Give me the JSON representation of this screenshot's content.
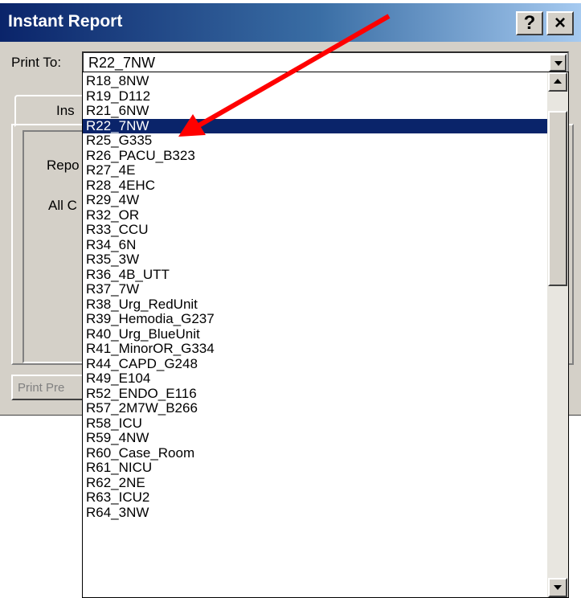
{
  "window": {
    "title": "Instant Report",
    "help_label": "?",
    "close_label": "×"
  },
  "print_to": {
    "label": "Print To:",
    "value": "R22_7NW"
  },
  "tab": {
    "label": "Ins"
  },
  "labels": {
    "report": "Repo",
    "all": "All C"
  },
  "print_preview": {
    "label": "Print Pre"
  },
  "dropdown": {
    "items": [
      "R18_8NW",
      "R19_D112",
      "R21_6NW",
      "R22_7NW",
      "R25_G335",
      "R26_PACU_B323",
      "R27_4E",
      "R28_4EHC",
      "R29_4W",
      "R32_OR",
      "R33_CCU",
      "R34_6N",
      "R35_3W",
      "R36_4B_UTT",
      "R37_7W",
      "R38_Urg_RedUnit",
      "R39_Hemodia_G237",
      "R40_Urg_BlueUnit",
      "R41_MinorOR_G334",
      "R44_CAPD_G248",
      "R49_E104",
      "R52_ENDO_E116",
      "R57_2M7W_B266",
      "R58_ICU",
      "R59_4NW",
      "R60_Case_Room",
      "R61_NICU",
      "R62_2NE",
      "R63_ICU2",
      "R64_3NW"
    ],
    "selected_index": 3
  },
  "colors": {
    "selection": "#0a246a",
    "annotation_arrow": "#ff0000"
  }
}
